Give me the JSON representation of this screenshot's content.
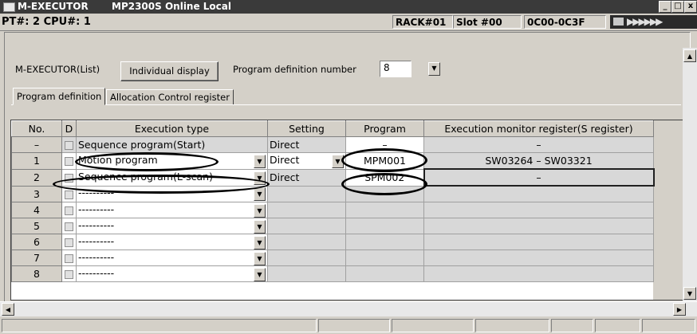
{
  "window": {
    "title": "M-EXECUTOR",
    "subtitle": "MP2300S  Online  Local",
    "min_label": "_",
    "max_label": "□",
    "close_label": "x"
  },
  "status": {
    "pt_cpu": "PT#: 2  CPU#: 1",
    "rack": "RACK#01",
    "slot": "Slot #00",
    "range": "0C00-0C3F",
    "indicator": "▶▶▶▶▶▶"
  },
  "controls": {
    "list_label": "M-EXECUTOR(List)",
    "individual_button": "Individual display",
    "program_def_number_label": "Program definition number",
    "program_def_number_value": "8"
  },
  "tabs": [
    {
      "label": "Program definition"
    },
    {
      "label": "Allocation Control register"
    }
  ],
  "table": {
    "columns": [
      "No.",
      "D",
      "Execution type",
      "Setting",
      "Program",
      "Execution monitor register(S register)"
    ],
    "rows": [
      {
        "no": "–",
        "type": "Sequence program(Start)",
        "setting": "Direct",
        "program": "–",
        "monitor": "–"
      },
      {
        "no": "1",
        "type": "Motion program",
        "setting": "Direct",
        "program": "MPM001",
        "monitor": "SW03264 – SW03321"
      },
      {
        "no": "2",
        "type": "Sequence program(L-scan)",
        "setting": "Direct",
        "program": "SPM002",
        "monitor": "–"
      },
      {
        "no": "3",
        "type": "----------",
        "setting": "",
        "program": "",
        "monitor": ""
      },
      {
        "no": "4",
        "type": "----------",
        "setting": "",
        "program": "",
        "monitor": ""
      },
      {
        "no": "5",
        "type": "----------",
        "setting": "",
        "program": "",
        "monitor": ""
      },
      {
        "no": "6",
        "type": "----------",
        "setting": "",
        "program": "",
        "monitor": ""
      },
      {
        "no": "7",
        "type": "----------",
        "setting": "",
        "program": "",
        "monitor": ""
      },
      {
        "no": "8",
        "type": "----------",
        "setting": "",
        "program": "",
        "monitor": ""
      }
    ]
  },
  "icons": [
    "app-icon",
    "monitor-icon",
    "dropdown-arrow-icon",
    "scroll-up-icon",
    "scroll-down-icon",
    "scroll-left-icon",
    "scroll-right-icon"
  ]
}
